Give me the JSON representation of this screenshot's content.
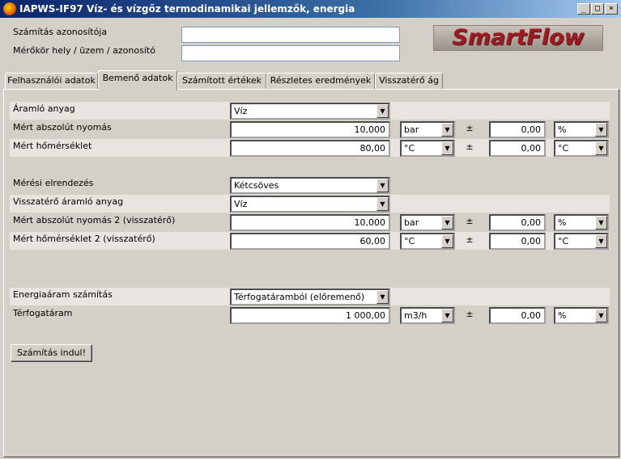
{
  "window": {
    "title": "IAPWS-IF97 Víz- és vízgőz termodinamikai jellemzők, energia",
    "controls": [
      "_",
      "□",
      "×"
    ]
  },
  "header": {
    "calc_id_label": "Számítás azonosítója",
    "calc_id_value": "",
    "meter_label": "Mérőkör hely / üzem / azonosító",
    "meter_value": "",
    "logo": "SmartFlow"
  },
  "tabs": [
    {
      "label": "Felhasználói adatok",
      "active": false
    },
    {
      "label": "Bemenő adatok",
      "active": true
    },
    {
      "label": "Számított értékek",
      "active": false
    },
    {
      "label": "Részletes eredmények",
      "active": false
    },
    {
      "label": "Visszatérő ág",
      "active": false
    }
  ],
  "rows": [
    {
      "label": "Áramló anyag",
      "value": "Víz"
    },
    {
      "label": "Mért abszolút nyomás",
      "value": "10,000",
      "unit": "bar",
      "pm": "±",
      "tol": "0,00",
      "tol_unit": "%"
    },
    {
      "label": "Mért hőmérséklet",
      "value": "80,00",
      "unit": "°C",
      "pm": "±",
      "tol": "0,00",
      "tol_unit": "°C"
    },
    {
      "label": "Mérési elrendezés",
      "value": "Kétcsöves"
    },
    {
      "label": "Visszatérő áramló anyag",
      "value": "Víz"
    },
    {
      "label": "Mért abszolút nyomás 2 (visszatérő)",
      "value": "10,000",
      "unit": "bar",
      "pm": "±",
      "tol": "0,00",
      "tol_unit": "%"
    },
    {
      "label": "Mért hőmérséklet 2  (visszatérő)",
      "value": "60,00",
      "unit": "°C",
      "pm": "±",
      "tol": "0,00",
      "tol_unit": "°C"
    },
    {
      "label": "Energiaáram számítás",
      "value": "Térfogatáramból (előremenő)"
    },
    {
      "label": "Térfogatáram",
      "value": "1 000,00",
      "unit": "m3/h",
      "pm": "±",
      "tol": "0,00",
      "tol_unit": "%"
    }
  ],
  "start_button": "Számítás indul!",
  "colors": {
    "titlebar": "#0a246a",
    "face": "#d4d0c8",
    "logo_text": "#a01820"
  }
}
